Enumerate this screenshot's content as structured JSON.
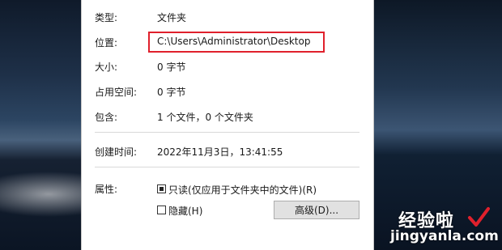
{
  "properties": {
    "type": {
      "label": "类型:",
      "value": "文件夹"
    },
    "location": {
      "label": "位置:",
      "value": "C:\\Users\\Administrator\\Desktop"
    },
    "size": {
      "label": "大小:",
      "value": "0 字节"
    },
    "size_on_disk": {
      "label": "占用空间:",
      "value": "0 字节"
    },
    "contains": {
      "label": "包含:",
      "value": "1 个文件，0 个文件夹"
    },
    "created": {
      "label": "创建时间:",
      "value": "2022年11月3日，13:41:55"
    },
    "attributes": {
      "label": "属性:",
      "readonly_label": "只读(仅应用于文件夹中的文件)(R)",
      "readonly_checked": true,
      "hidden_label": "隐藏(H)",
      "hidden_checked": false,
      "advanced_button": "高级(D)..."
    }
  },
  "watermark": {
    "text": "经验啦",
    "url": "jingyanla.com",
    "check_color": "#e0202c"
  },
  "colors": {
    "highlight": "#e0202c"
  }
}
